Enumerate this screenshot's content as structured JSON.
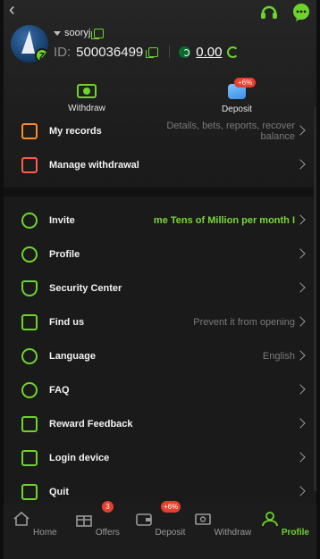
{
  "user": {
    "username": "sooryj",
    "id_label": "ID:",
    "id_value": "500036499",
    "balance": "0.00"
  },
  "quick_actions": {
    "withdraw": "Withdraw",
    "deposit": "Deposit",
    "deposit_bonus": "+6%"
  },
  "records": [
    {
      "label": "My records",
      "hint": "Details, bets, reports, recover balance",
      "icon": "records-icon"
    },
    {
      "label": "Manage withdrawal",
      "hint": "",
      "icon": "withdrawal-card-icon"
    }
  ],
  "menu": [
    {
      "label": "Invite",
      "hint": "me Tens of Million per month  I",
      "icon": "invite-icon"
    },
    {
      "label": "Profile",
      "hint": "",
      "icon": "user-edit-icon"
    },
    {
      "label": "Security Center",
      "hint": "",
      "icon": "shield-icon"
    },
    {
      "label": "Find us",
      "hint": "Prevent it from opening",
      "icon": "search-doc-icon"
    },
    {
      "label": "Language",
      "hint": "English",
      "icon": "globe-icon"
    },
    {
      "label": "FAQ",
      "hint": "",
      "icon": "question-icon"
    },
    {
      "label": "Reward Feedback",
      "hint": "",
      "icon": "edit-icon"
    },
    {
      "label": "Login device",
      "hint": "",
      "icon": "phone-icon"
    },
    {
      "label": "Quit",
      "hint": "",
      "icon": "logout-icon"
    }
  ],
  "tabs": [
    {
      "label": "Home",
      "badge": ""
    },
    {
      "label": "Offers",
      "badge": "3"
    },
    {
      "label": "Deposit",
      "badge": "+6%"
    },
    {
      "label": "Withdraw",
      "badge": ""
    },
    {
      "label": "Profile",
      "badge": ""
    }
  ],
  "colors": {
    "accent": "#6ed42c",
    "badge": "#e5402e",
    "background": "#1a1a1a"
  }
}
